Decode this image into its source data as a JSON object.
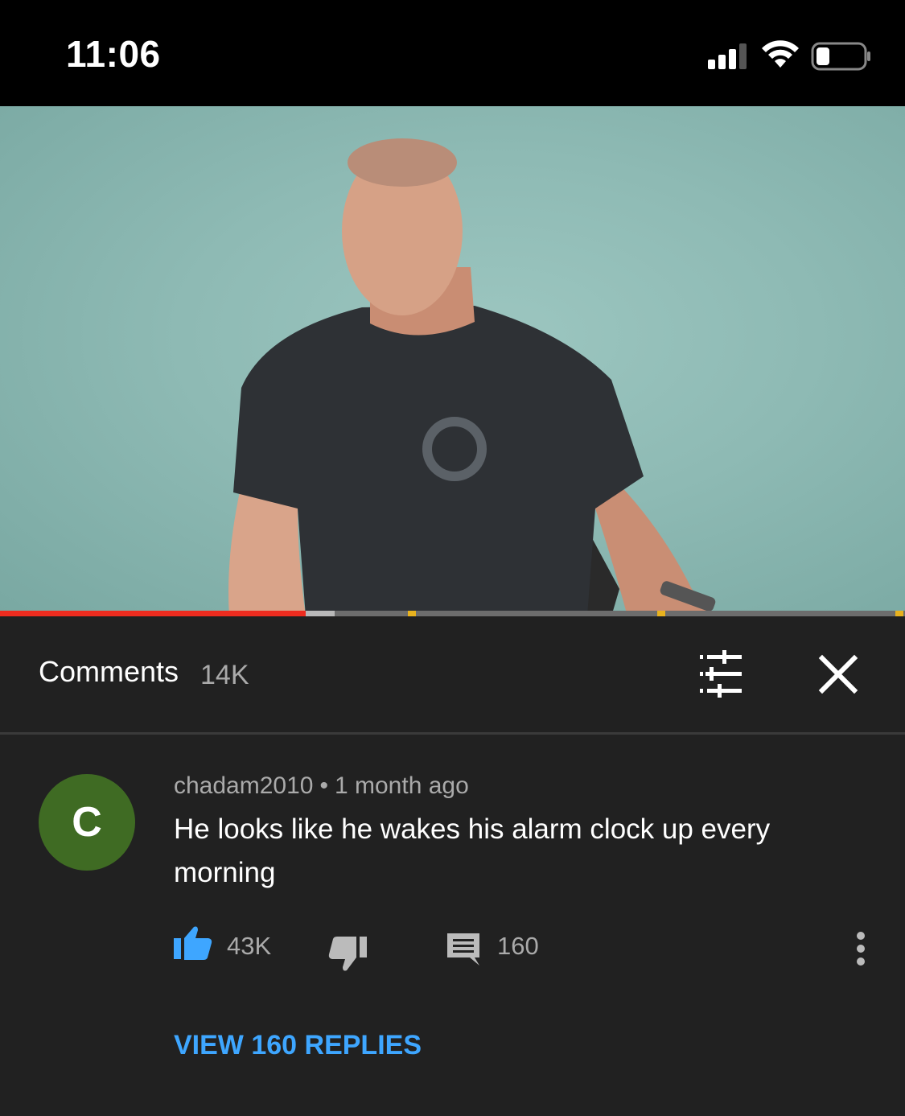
{
  "status_bar": {
    "time": "11:06",
    "signal_icon": "cellular-signal-icon",
    "wifi_icon": "wifi-icon",
    "battery_icon": "battery-icon"
  },
  "video": {
    "progress_fraction": 0.338,
    "buffered_fraction": 0.37
  },
  "comments_header": {
    "title": "Comments",
    "count": "14K",
    "filter_icon": "sort-filter-icon",
    "close_icon": "close-icon"
  },
  "comment": {
    "avatar_letter": "C",
    "avatar_color": "#3f6b23",
    "author": "chadam2010",
    "separator": "•",
    "time": "1 month ago",
    "text": "He looks like he wakes his alarm clock up every morning",
    "likes": "43K",
    "like_icon": "thumbs-up-icon",
    "dislike_icon": "thumbs-down-icon",
    "reply_icon": "reply-comment-icon",
    "reply_count": "160",
    "more_icon": "more-vertical-icon",
    "view_replies": "VIEW 160 REPLIES"
  },
  "colors": {
    "accent_blue": "#3ea6ff",
    "progress_red": "#ee2c1f",
    "background": "#212121"
  }
}
